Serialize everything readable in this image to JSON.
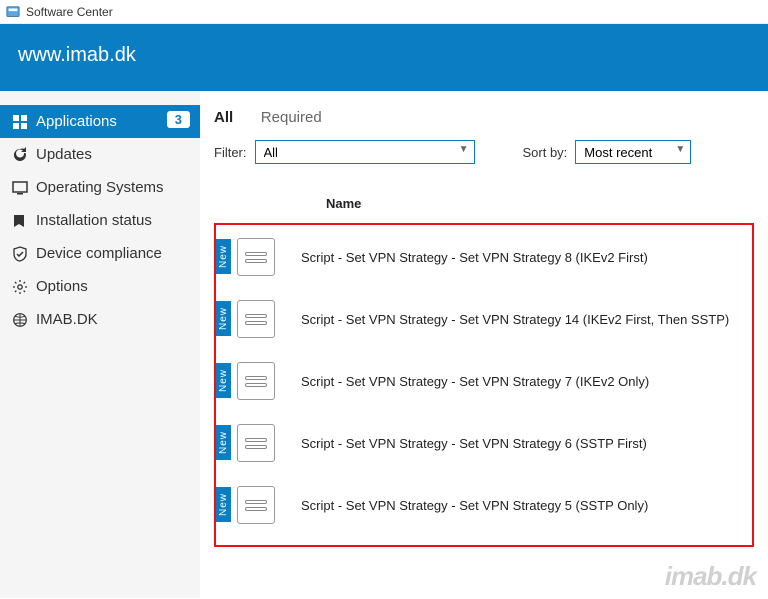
{
  "window": {
    "title": "Software Center"
  },
  "banner": {
    "site": "www.imab.dk"
  },
  "sidebar": {
    "items": [
      {
        "label": "Applications",
        "badge": "3",
        "icon": "applications"
      },
      {
        "label": "Updates",
        "icon": "updates"
      },
      {
        "label": "Operating Systems",
        "icon": "os"
      },
      {
        "label": "Installation status",
        "icon": "status"
      },
      {
        "label": "Device compliance",
        "icon": "compliance"
      },
      {
        "label": "Options",
        "icon": "options"
      },
      {
        "label": "IMAB.DK",
        "icon": "globe"
      }
    ]
  },
  "tabs": {
    "all": "All",
    "required": "Required"
  },
  "filter": {
    "label": "Filter:",
    "selected": "All",
    "sort_label": "Sort by:",
    "sort_selected": "Most recent"
  },
  "columns": {
    "name": "Name"
  },
  "new_flag": "New",
  "apps": [
    {
      "name": "Script - Set VPN Strategy - Set VPN Strategy 8 (IKEv2 First)"
    },
    {
      "name": "Script - Set VPN Strategy - Set VPN Strategy 14 (IKEv2 First, Then SSTP)"
    },
    {
      "name": "Script - Set VPN Strategy - Set VPN Strategy 7 (IKEv2 Only)"
    },
    {
      "name": "Script - Set VPN Strategy - Set VPN Strategy 6 (SSTP First)"
    },
    {
      "name": "Script - Set VPN Strategy - Set VPN Strategy 5 (SSTP Only)"
    }
  ],
  "watermark": "imab.dk"
}
